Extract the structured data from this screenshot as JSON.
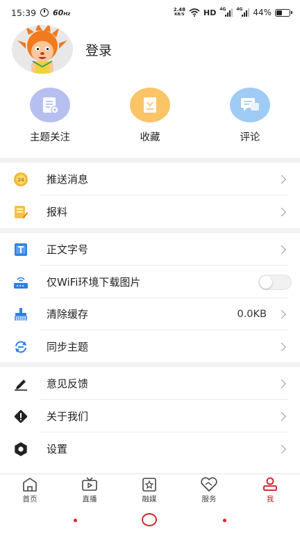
{
  "status_bar": {
    "time": "15:39",
    "fps": "60",
    "fps_unit": "Hz",
    "net_speed": "2.48",
    "net_unit": "KB/S",
    "hd": "HD",
    "sim_label": "4G",
    "battery": "44%",
    "battery_level": 0.44
  },
  "profile": {
    "login": "登录"
  },
  "quick_actions": [
    {
      "label": "主题关注",
      "icon": "topic-follow-icon",
      "color": "#b6bff0"
    },
    {
      "label": "收藏",
      "icon": "favorites-icon",
      "color": "#fbc467"
    },
    {
      "label": "评论",
      "icon": "comment-icon",
      "color": "#9fcbf5"
    }
  ],
  "menu": {
    "push": "推送消息",
    "report": "报料",
    "font_size": "正文字号",
    "wifi_download": "仅WiFi环境下载图片",
    "wifi_download_enabled": false,
    "clear_cache": "清除缓存",
    "cache_size": "0.0KB",
    "sync_topic": "同步主题",
    "feedback": "意见反馈",
    "about": "关于我们",
    "settings": "设置"
  },
  "bottom_nav": [
    {
      "label": "首页",
      "icon": "home-icon",
      "active": false
    },
    {
      "label": "直播",
      "icon": "live-tv-icon",
      "active": false
    },
    {
      "label": "融媒",
      "icon": "media-icon",
      "active": false
    },
    {
      "label": "服务",
      "icon": "service-icon",
      "active": false
    },
    {
      "label": "我",
      "icon": "profile-icon",
      "active": true
    }
  ],
  "colors": {
    "accent": "#c8161d",
    "system_nav": "#d6262d"
  }
}
